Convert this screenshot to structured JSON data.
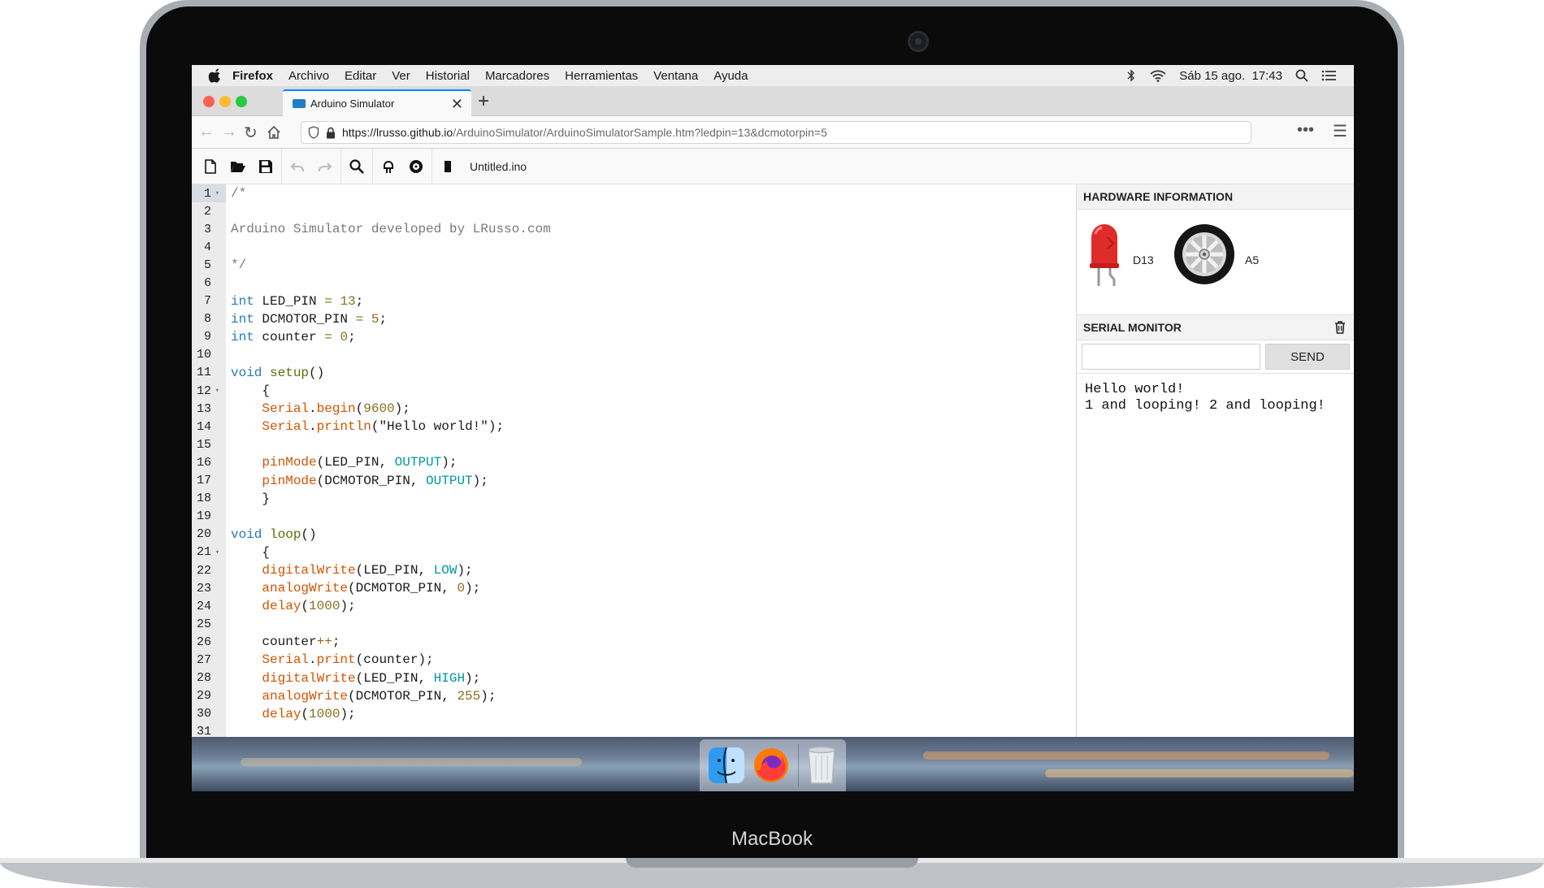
{
  "device": {
    "brand": "MacBook"
  },
  "menubar": {
    "items": [
      "Firefox",
      "Archivo",
      "Editar",
      "Ver",
      "Historial",
      "Marcadores",
      "Herramientas",
      "Ventana",
      "Ayuda"
    ],
    "clock": "Sáb 15 ago.  17:43"
  },
  "browser": {
    "tab_title": "Arduino Simulator",
    "url_host": "https://lrusso.github.io",
    "url_path": "/ArduinoSimulator/ArduinoSimulatorSample.htm?ledpin=13&dcmotorpin=5"
  },
  "toolbar": {
    "filename": "Untitled.ino"
  },
  "code": [
    [
      [
        "c",
        "/*"
      ]
    ],
    [],
    [
      [
        "c",
        "Arduino Simulator developed by LRusso.com"
      ]
    ],
    [],
    [
      [
        "c",
        "*/"
      ]
    ],
    [],
    [
      [
        "t",
        "int"
      ],
      [
        "p",
        " LED_PIN "
      ],
      [
        "n",
        "="
      ],
      [
        "p",
        " "
      ],
      [
        "n",
        "13"
      ],
      [
        "p",
        ";"
      ]
    ],
    [
      [
        "t",
        "int"
      ],
      [
        "p",
        " DCMOTOR_PIN "
      ],
      [
        "n",
        "="
      ],
      [
        "p",
        " "
      ],
      [
        "n",
        "5"
      ],
      [
        "p",
        ";"
      ]
    ],
    [
      [
        "t",
        "int"
      ],
      [
        "p",
        " counter "
      ],
      [
        "n",
        "="
      ],
      [
        "p",
        " "
      ],
      [
        "n",
        "0"
      ],
      [
        "p",
        ";"
      ]
    ],
    [],
    [
      [
        "t",
        "void"
      ],
      [
        "p",
        " "
      ],
      [
        "k",
        "setup"
      ],
      [
        "p",
        "()"
      ]
    ],
    [
      [
        "p",
        "    {"
      ]
    ],
    [
      [
        "p",
        "    "
      ],
      [
        "f",
        "Serial"
      ],
      [
        "p",
        "."
      ],
      [
        "f",
        "begin"
      ],
      [
        "p",
        "("
      ],
      [
        "n",
        "9600"
      ],
      [
        "p",
        ");"
      ]
    ],
    [
      [
        "p",
        "    "
      ],
      [
        "f",
        "Serial"
      ],
      [
        "p",
        "."
      ],
      [
        "f",
        "println"
      ],
      [
        "p",
        "(\"Hello world!\");"
      ]
    ],
    [],
    [
      [
        "p",
        "    "
      ],
      [
        "f",
        "pinMode"
      ],
      [
        "p",
        "(LED_PIN, "
      ],
      [
        "k2",
        "OUTPUT"
      ],
      [
        "p",
        ");"
      ]
    ],
    [
      [
        "p",
        "    "
      ],
      [
        "f",
        "pinMode"
      ],
      [
        "p",
        "(DCMOTOR_PIN, "
      ],
      [
        "k2",
        "OUTPUT"
      ],
      [
        "p",
        ");"
      ]
    ],
    [
      [
        "p",
        "    }"
      ]
    ],
    [],
    [
      [
        "t",
        "void"
      ],
      [
        "p",
        " "
      ],
      [
        "k",
        "loop"
      ],
      [
        "p",
        "()"
      ]
    ],
    [
      [
        "p",
        "    {"
      ]
    ],
    [
      [
        "p",
        "    "
      ],
      [
        "f",
        "digitalWrite"
      ],
      [
        "p",
        "(LED_PIN, "
      ],
      [
        "k2",
        "LOW"
      ],
      [
        "p",
        ");"
      ]
    ],
    [
      [
        "p",
        "    "
      ],
      [
        "f",
        "analogWrite"
      ],
      [
        "p",
        "(DCMOTOR_PIN, "
      ],
      [
        "n",
        "0"
      ],
      [
        "p",
        ");"
      ]
    ],
    [
      [
        "p",
        "    "
      ],
      [
        "f",
        "delay"
      ],
      [
        "p",
        "("
      ],
      [
        "n",
        "1000"
      ],
      [
        "p",
        ");"
      ]
    ],
    [],
    [
      [
        "p",
        "    counter"
      ],
      [
        "n",
        "++"
      ],
      [
        "p",
        ";"
      ]
    ],
    [
      [
        "p",
        "    "
      ],
      [
        "f",
        "Serial"
      ],
      [
        "p",
        "."
      ],
      [
        "f",
        "print"
      ],
      [
        "p",
        "(counter);"
      ]
    ],
    [
      [
        "p",
        "    "
      ],
      [
        "f",
        "digitalWrite"
      ],
      [
        "p",
        "(LED_PIN, "
      ],
      [
        "k2",
        "HIGH"
      ],
      [
        "p",
        ");"
      ]
    ],
    [
      [
        "p",
        "    "
      ],
      [
        "f",
        "analogWrite"
      ],
      [
        "p",
        "(DCMOTOR_PIN, "
      ],
      [
        "n",
        "255"
      ],
      [
        "p",
        ");"
      ]
    ],
    [
      [
        "p",
        "    "
      ],
      [
        "f",
        "delay"
      ],
      [
        "p",
        "("
      ],
      [
        "n",
        "1000"
      ],
      [
        "p",
        ");"
      ]
    ],
    []
  ],
  "fold_lines": [
    1,
    12,
    21
  ],
  "active_line": 1,
  "hardware": {
    "title": "HARDWARE INFORMATION",
    "led_pin": "D13",
    "motor_pin": "A5"
  },
  "serial": {
    "title": "SERIAL MONITOR",
    "input_value": "",
    "send_label": "SEND",
    "output_lines": [
      "Hello world!",
      "1 and looping! 2 and looping!"
    ]
  },
  "colors": {
    "led": "#e02b2b",
    "accent": "#0a84ff",
    "close": "#fe5f57",
    "minimize": "#febc2e",
    "maximize": "#28c840"
  },
  "dock": {
    "apps": [
      "finder-icon",
      "firefox-icon",
      "trash-icon"
    ]
  }
}
